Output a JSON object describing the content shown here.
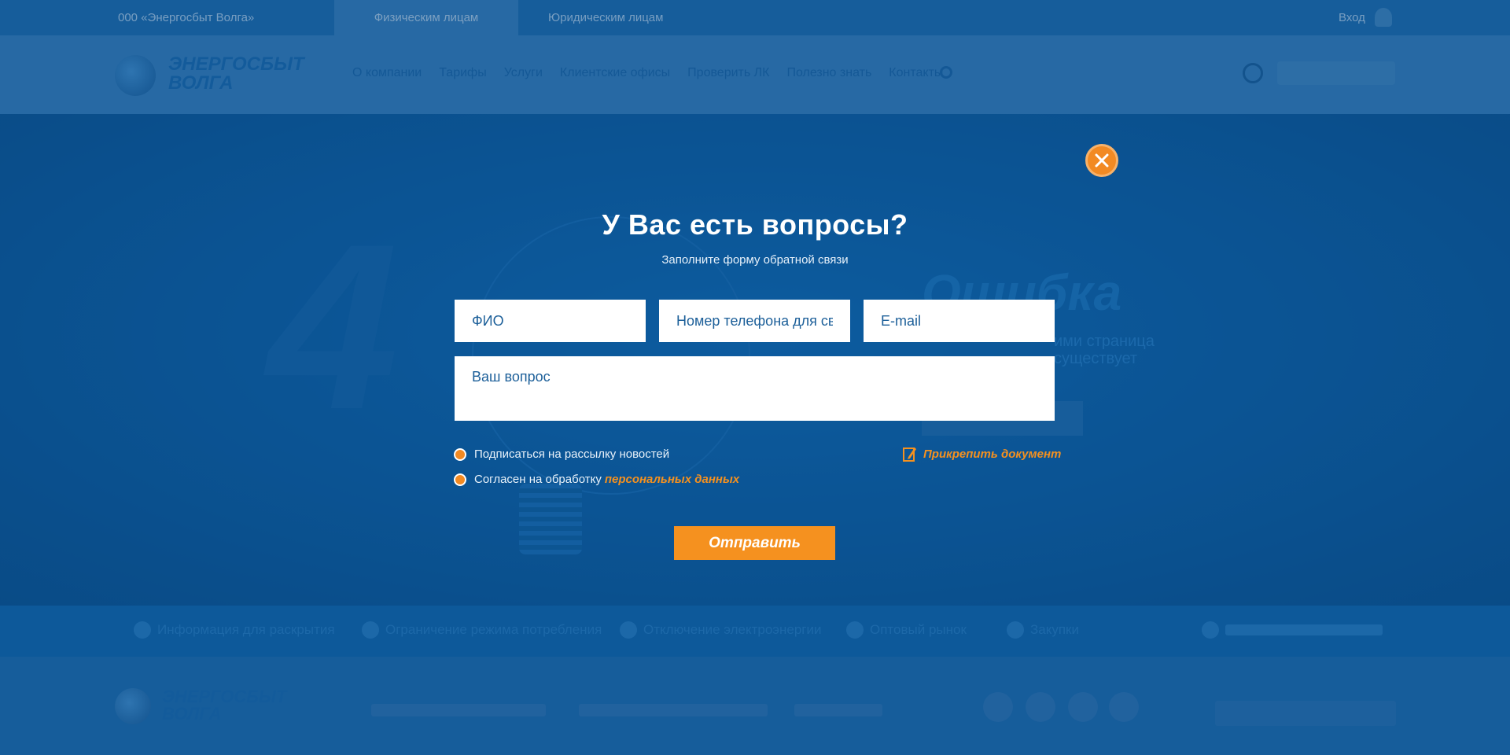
{
  "background": {
    "topbar": {
      "left_text": "000 «Энергосбыт Волга»",
      "active_tab": "Физическим лицам",
      "second_tab": "Юридическим лицам",
      "login": "Вход"
    },
    "logo": {
      "line1": "ЭНЕРГОСБЫТ",
      "line2": "ВОЛГА"
    },
    "nav": [
      "О компании",
      "Тарифы",
      "Услуги",
      "Клиентские офисы",
      "Проверить ЛК",
      "Полезно знать",
      "Контакты"
    ],
    "hero": {
      "number": "4",
      "error_title": "Ошибка",
      "error_desc_1": "ими страница",
      "error_desc_2": "существует"
    },
    "infobar": [
      "Информация для раскрытия",
      "Ограничение режима потребления",
      "Отключение электроэнергии",
      "Оптовый рынок",
      "Закупки"
    ],
    "footer_logo": {
      "line1": "ЭНЕРГОСБЫТ",
      "line2": "ВОЛГА"
    }
  },
  "modal": {
    "title": "У Вас есть вопросы?",
    "subtitle": "Заполните форму обратной связи",
    "fields": {
      "name_placeholder": "ФИО",
      "phone_placeholder": "Номер телефона для связи",
      "email_placeholder": "E-mail",
      "question_placeholder": "Ваш вопрос"
    },
    "subscribe_label": "Подписаться на рассылку новостей",
    "consent_label": "Согласен на обработку",
    "consent_link": "персональных данных",
    "attach_label": "Прикрепить документ",
    "submit_label": "Отправить"
  },
  "colors": {
    "accent": "#f5911f",
    "field_text": "#1c5f99",
    "overlay": "#0a5a9c"
  }
}
